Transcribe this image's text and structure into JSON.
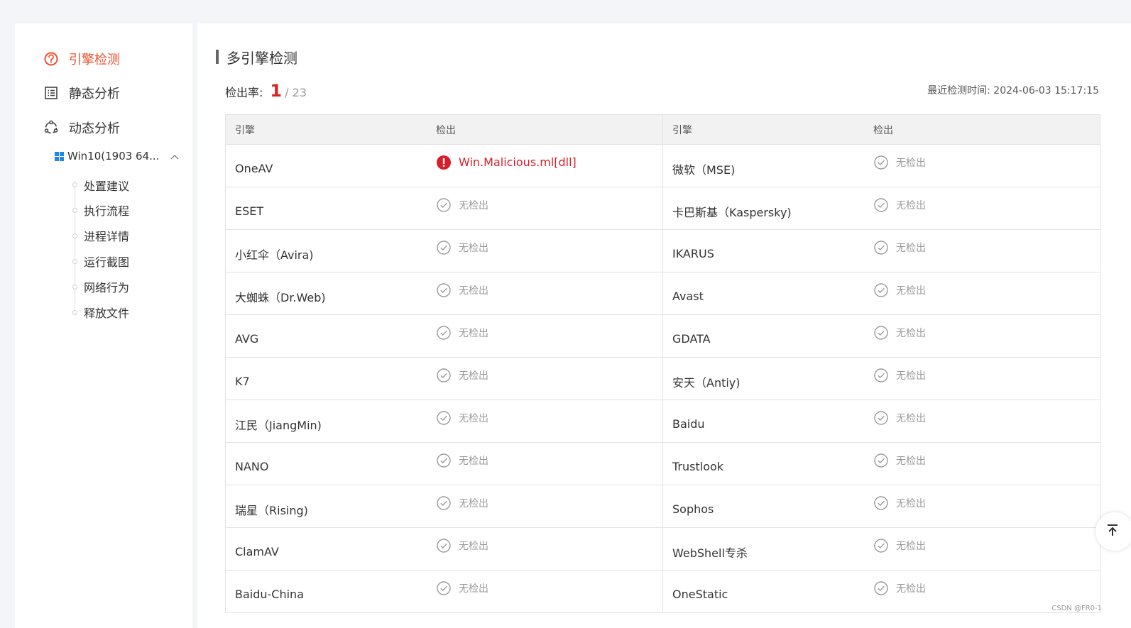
{
  "sidebar": {
    "nav": [
      {
        "label": "引擎检测",
        "icon": "engine-icon",
        "active": true
      },
      {
        "label": "静态分析",
        "icon": "list-icon",
        "active": false
      },
      {
        "label": "动态分析",
        "icon": "dynamic-icon",
        "active": false
      }
    ],
    "os_label": "Win10(1903 64...",
    "sub_items": [
      "处置建议",
      "执行流程",
      "进程详情",
      "运行截图",
      "网络行为",
      "释放文件"
    ]
  },
  "main": {
    "title": "多引擎检测",
    "rate_label": "检出率:",
    "rate_detected": "1",
    "rate_total": "/ 23",
    "last_detect_label": "最近检测时间:",
    "last_detect_time": "2024-06-03 15:17:15",
    "table": {
      "headers": [
        "引擎",
        "检出",
        "引擎",
        "检出"
      ],
      "rows": [
        [
          {
            "engine": "OneAV",
            "result": "Win.Malicious.ml[dll]",
            "malicious": true
          },
          {
            "engine": "微软（MSE)",
            "result": "无检出",
            "malicious": false
          }
        ],
        [
          {
            "engine": "ESET",
            "result": "无检出",
            "malicious": false
          },
          {
            "engine": "卡巴斯基（Kaspersky)",
            "result": "无检出",
            "malicious": false
          }
        ],
        [
          {
            "engine": "小红伞（Avira)",
            "result": "无检出",
            "malicious": false
          },
          {
            "engine": "IKARUS",
            "result": "无检出",
            "malicious": false
          }
        ],
        [
          {
            "engine": "大蜘蛛（Dr.Web)",
            "result": "无检出",
            "malicious": false
          },
          {
            "engine": "Avast",
            "result": "无检出",
            "malicious": false
          }
        ],
        [
          {
            "engine": "AVG",
            "result": "无检出",
            "malicious": false
          },
          {
            "engine": "GDATA",
            "result": "无检出",
            "malicious": false
          }
        ],
        [
          {
            "engine": "K7",
            "result": "无检出",
            "malicious": false
          },
          {
            "engine": "安天（Antiy)",
            "result": "无检出",
            "malicious": false
          }
        ],
        [
          {
            "engine": "江民（JiangMin)",
            "result": "无检出",
            "malicious": false
          },
          {
            "engine": "Baidu",
            "result": "无检出",
            "malicious": false
          }
        ],
        [
          {
            "engine": "NANO",
            "result": "无检出",
            "malicious": false
          },
          {
            "engine": "Trustlook",
            "result": "无检出",
            "malicious": false
          }
        ],
        [
          {
            "engine": "瑞星（Rising)",
            "result": "无检出",
            "malicious": false
          },
          {
            "engine": "Sophos",
            "result": "无检出",
            "malicious": false
          }
        ],
        [
          {
            "engine": "ClamAV",
            "result": "无检出",
            "malicious": false
          },
          {
            "engine": "WebShell专杀",
            "result": "无检出",
            "malicious": false
          }
        ],
        [
          {
            "engine": "Baidu-China",
            "result": "无检出",
            "malicious": false
          },
          {
            "engine": "OneStatic",
            "result": "无检出",
            "malicious": false
          }
        ]
      ]
    }
  },
  "watermark": "CSDN @FR0-1",
  "colors": {
    "accent": "#f0522e",
    "malicious": "#d81e2a",
    "ok": "#999999"
  }
}
